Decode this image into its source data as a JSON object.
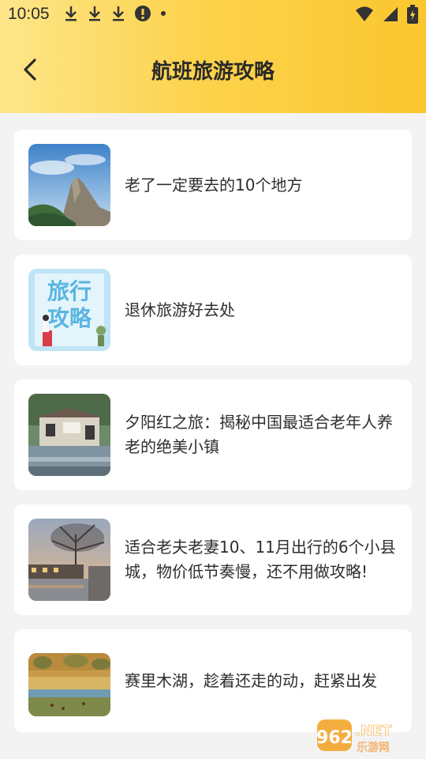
{
  "status": {
    "time": "10:05"
  },
  "header": {
    "title": "航班旅游攻略"
  },
  "articles": [
    {
      "title": "老了一定要去的10个地方"
    },
    {
      "title": "退休旅游好去处"
    },
    {
      "title": "夕阳红之旅：揭秘中国最适合老年人养老的绝美小镇"
    },
    {
      "title": "适合老夫老妻10、11月出行的6个小县城，物价低节奏慢，还不用做攻略!"
    },
    {
      "title": "赛里木湖，趁着还走的动，赶紧出发"
    }
  ],
  "thumb2_text": {
    "line1": "旅行",
    "line2": "攻略"
  },
  "watermark": {
    "number": "962",
    "suffix": ".NET",
    "sub": "乐游网"
  },
  "colors": {
    "header_left": "#fde68a",
    "header_right": "#fbc62f",
    "background": "#f3f3f3"
  }
}
